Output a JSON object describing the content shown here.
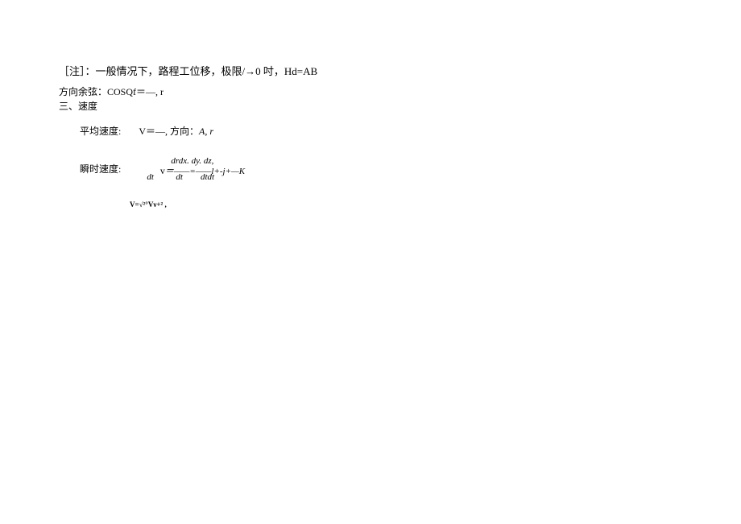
{
  "line1": {
    "prefix": "［注］：一般情况下，路程工位移，极限/",
    "arrow": "→",
    "suffix": "0 吋，Hd=AB"
  },
  "line2": {
    "label": "方向余弦：",
    "formula": "COSQf＝—, r"
  },
  "line3": "三、速度",
  "line4": {
    "label": "平均速度:",
    "formula": "V＝—,",
    "dir_label": "方向：",
    "dir_value": "A, r"
  },
  "line5": {
    "label": "瞬时速度:",
    "top": "drdx. dy. dz,",
    "mid_v": "v",
    "mid_rest": "＝——=——l+-j+—K",
    "bot_dt1": "dt",
    "bot_dt2": "dt",
    "bot_dt3": "dtdt"
  },
  "line6": {
    "text": "V=√²°Vν+² ,"
  }
}
